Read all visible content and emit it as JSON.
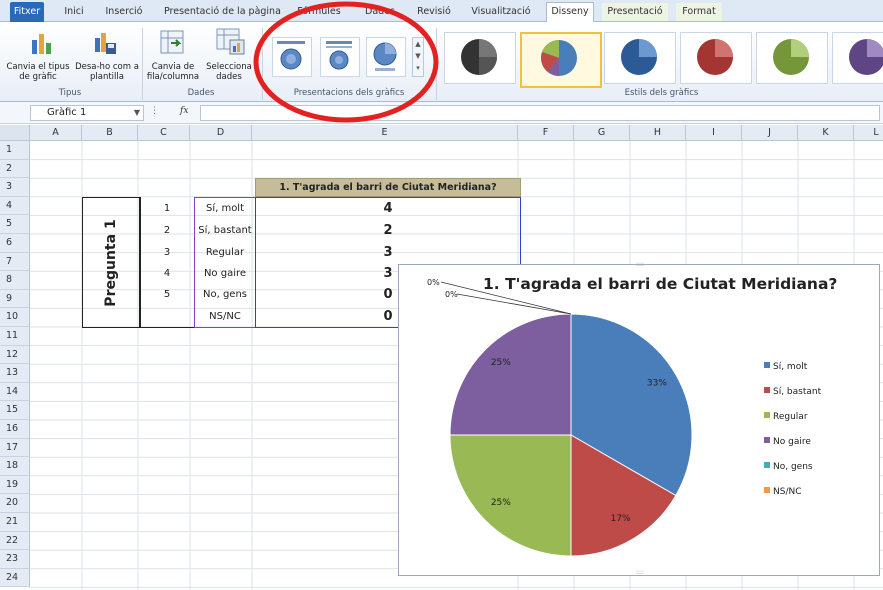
{
  "tabs": [
    "Fitxer",
    "Inici",
    "Inserció",
    "Presentació de la pàgina",
    "Fórmules",
    "Dades",
    "Revisió",
    "Visualització",
    "Disseny",
    "Presentació",
    "Format"
  ],
  "ribbon": {
    "change_type": "Canvia el tipus de gràfic",
    "save_template": "Desa-ho com a plantilla",
    "group_types": "Tipus",
    "switch_row_col": "Canvia de fila/columna",
    "select_data": "Selecciona dades",
    "group_data": "Dades",
    "group_layouts": "Presentacions dels gràfics",
    "group_styles": "Estils dels gràfics"
  },
  "formula_bar": {
    "name_box": "Gràfic 1",
    "fx": "fx",
    "formula": ""
  },
  "columns": [
    "A",
    "B",
    "C",
    "D",
    "E",
    "F",
    "G",
    "H",
    "I",
    "J",
    "K",
    "L"
  ],
  "rows": [
    "1",
    "2",
    "3",
    "4",
    "5",
    "6",
    "7",
    "8",
    "9",
    "10",
    "11",
    "12",
    "13",
    "14",
    "15",
    "16",
    "17",
    "18",
    "19",
    "20",
    "21",
    "22",
    "23",
    "24"
  ],
  "sheet": {
    "header": "1. T'agrada el barri de Ciutat Meridiana?",
    "question_label": "Pregunta 1",
    "data_rows": [
      {
        "num": "1",
        "label": "Sí, molt",
        "value": "4"
      },
      {
        "num": "2",
        "label": "Sí, bastant",
        "value": "2"
      },
      {
        "num": "3",
        "label": "Regular",
        "value": "3"
      },
      {
        "num": "4",
        "label": "No gaire",
        "value": "3"
      },
      {
        "num": "5",
        "label": "No, gens",
        "value": "0"
      },
      {
        "num": "",
        "label": "NS/NC",
        "value": "0"
      }
    ]
  },
  "chart_data": {
    "type": "pie",
    "title": "1. T'agrada el barri de Ciutat Meridiana?",
    "categories": [
      "Sí, molt",
      "Sí, bastant",
      "Regular",
      "No gaire",
      "No, gens",
      "NS/NC"
    ],
    "values": [
      4,
      2,
      3,
      3,
      0,
      0
    ],
    "data_labels": [
      "33%",
      "17%",
      "25%",
      "25%",
      "0%",
      "0%"
    ],
    "colors": [
      "#4a7ebb",
      "#be4b48",
      "#98b954",
      "#7d5fa0",
      "#46aac4",
      "#f79646"
    ],
    "legend": "right"
  },
  "accent": {
    "annotation_circle": "#e32121",
    "selection": "#2f5fd0",
    "active_tab": "#ffffff"
  }
}
